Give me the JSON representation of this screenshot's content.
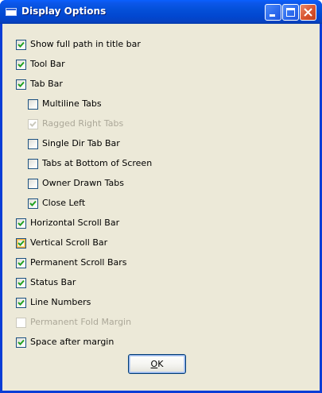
{
  "window": {
    "title": "Display Options",
    "icon": "window-icon"
  },
  "options": [
    {
      "id": "show-full-path",
      "label": "Show full path in title bar",
      "checked": true,
      "disabled": false,
      "indent": false,
      "hover": false
    },
    {
      "id": "tool-bar",
      "label": "Tool Bar",
      "checked": true,
      "disabled": false,
      "indent": false,
      "hover": false
    },
    {
      "id": "tab-bar",
      "label": "Tab Bar",
      "checked": true,
      "disabled": false,
      "indent": false,
      "hover": false
    },
    {
      "id": "multiline-tabs",
      "label": "Multiline Tabs",
      "checked": false,
      "disabled": false,
      "indent": true,
      "hover": false
    },
    {
      "id": "ragged-right-tabs",
      "label": "Ragged Right Tabs",
      "checked": true,
      "disabled": true,
      "indent": true,
      "hover": false
    },
    {
      "id": "single-dir-tab-bar",
      "label": "Single Dir Tab Bar",
      "checked": false,
      "disabled": false,
      "indent": true,
      "hover": false
    },
    {
      "id": "tabs-at-bottom",
      "label": "Tabs at Bottom of Screen",
      "checked": false,
      "disabled": false,
      "indent": true,
      "hover": false
    },
    {
      "id": "owner-drawn-tabs",
      "label": "Owner Drawn Tabs",
      "checked": false,
      "disabled": false,
      "indent": true,
      "hover": false
    },
    {
      "id": "close-left",
      "label": "Close Left",
      "checked": true,
      "disabled": false,
      "indent": true,
      "hover": false
    },
    {
      "id": "horizontal-scroll-bar",
      "label": "Horizontal Scroll Bar",
      "checked": true,
      "disabled": false,
      "indent": false,
      "hover": false
    },
    {
      "id": "vertical-scroll-bar",
      "label": "Vertical Scroll Bar",
      "checked": true,
      "disabled": false,
      "indent": false,
      "hover": true
    },
    {
      "id": "permanent-scroll-bars",
      "label": "Permanent Scroll Bars",
      "checked": true,
      "disabled": false,
      "indent": false,
      "hover": false
    },
    {
      "id": "status-bar",
      "label": "Status Bar",
      "checked": true,
      "disabled": false,
      "indent": false,
      "hover": false
    },
    {
      "id": "line-numbers",
      "label": "Line Numbers",
      "checked": true,
      "disabled": false,
      "indent": false,
      "hover": false
    },
    {
      "id": "permanent-fold-margin",
      "label": "Permanent Fold Margin",
      "checked": false,
      "disabled": true,
      "indent": false,
      "hover": false
    },
    {
      "id": "space-after-margin",
      "label": "Space after margin",
      "checked": true,
      "disabled": false,
      "indent": false,
      "hover": false
    }
  ],
  "buttons": {
    "ok_mnemonic": "O",
    "ok_rest": "K"
  },
  "colors": {
    "check": "#21a121",
    "check_disabled": "#cac8bb"
  }
}
